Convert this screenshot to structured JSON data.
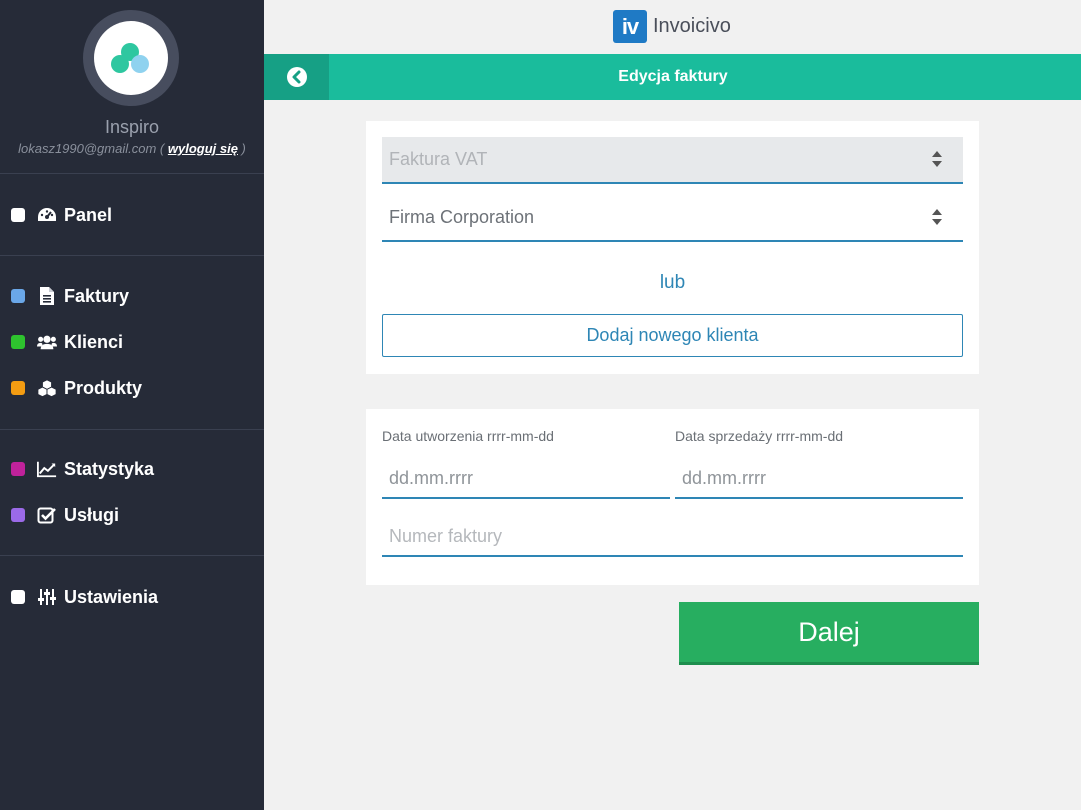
{
  "brand": {
    "logo_text": "iv",
    "name": "Invoicivo"
  },
  "user": {
    "org_name": "Inspiro",
    "email": "lokasz1990@gmail.com",
    "logout_label": "wyloguj się"
  },
  "nav": [
    {
      "label": "Panel",
      "icon": "dashboard-icon",
      "color": "#ffffff"
    },
    {
      "label": "Faktury",
      "icon": "document-icon",
      "color": "#6aa7e8"
    },
    {
      "label": "Klienci",
      "icon": "users-icon",
      "color": "#2ec32e"
    },
    {
      "label": "Produkty",
      "icon": "cubes-icon",
      "color": "#f39c12"
    },
    {
      "label": "Statystyka",
      "icon": "chart-line-icon",
      "color": "#c0229b"
    },
    {
      "label": "Usługi",
      "icon": "check-square-icon",
      "color": "#9b6ae8"
    },
    {
      "label": "Ustawienia",
      "icon": "sliders-icon",
      "color": "#ffffff"
    }
  ],
  "header": {
    "title": "Edycja faktury"
  },
  "form": {
    "doc_type": {
      "value": "Faktura VAT"
    },
    "client": {
      "value": "Firma Corporation"
    },
    "or_text": "lub",
    "add_client_label": "Dodaj nowego klienta",
    "created_date": {
      "label": "Data utworzenia rrrr-mm-dd",
      "value": "dd.mm.rrrr"
    },
    "sale_date": {
      "label": "Data sprzedaży rrrr-mm-dd",
      "value": "dd.mm.rrrr"
    },
    "invoice_number": {
      "placeholder": "Numer faktury"
    },
    "next_label": "Dalej"
  },
  "colors": {
    "accent": "#1abc9c",
    "primary": "#2e86b5",
    "success": "#27ae60",
    "sidebar": "#262b38"
  }
}
